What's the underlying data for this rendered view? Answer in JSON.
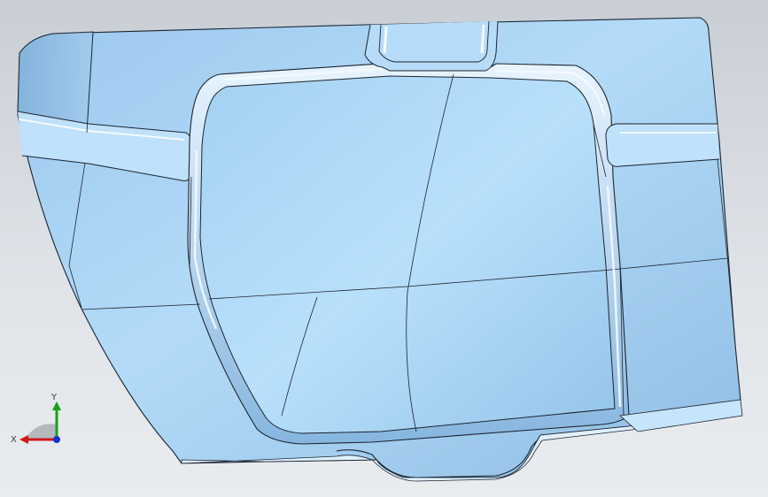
{
  "viewport": {
    "background_top": "#c9ced5",
    "background_bottom": "#e9ecef"
  },
  "model": {
    "name": "sheet-metal-panel",
    "surface_color": "#a9d3f3",
    "surface_shade": "#7fb2dc",
    "edge_color": "#1c2430",
    "highlight_color": "#f2f8ff"
  },
  "triad": {
    "x_label": "X",
    "y_label": "Y",
    "x_color": "#d01818",
    "y_color": "#18a018",
    "z_color": "#1830d0"
  }
}
